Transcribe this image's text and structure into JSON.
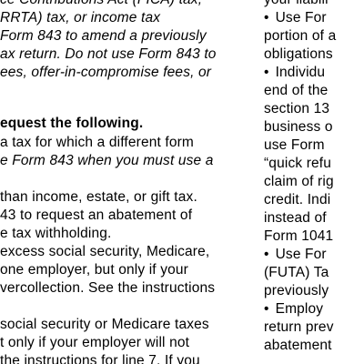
{
  "left_column": {
    "p1_line1": "ce Contributions Act (FICA) tax,",
    "p1_line2": "RRTA) tax, or income tax",
    "p1_line3": "Form 843 to amend a previously",
    "p1_line4": "ax return. Do not use Form 843 to",
    "p1_line5": "ees, offer-in-compromise fees, or",
    "heading": "equest the following.",
    "p2_line1": "a tax for which a different form",
    "p2_line2": "e Form 843 when you must use a",
    "p3_line1": "than income, estate, or gift tax.",
    "p3_line2": "43 to request an abatement of",
    "p3_line3": "e tax withholding.",
    "p4_line1": "excess social security, Medicare,",
    "p4_line2": "one employer, but only if your",
    "p4_line3": "vercollection. See the instructions",
    "p5_line1": "social security or Medicare taxes",
    "p5_line2": "t only if your employer will not",
    "p5_line3": "the instructions for line 7. If you"
  },
  "right_column": {
    "r1": "your liabili",
    "b1_l1": "Use For",
    "b1_l2": "portion of a",
    "b1_l3": "obligations",
    "b2_l1": "Individu",
    "b2_l2": "end of the",
    "b2_l3": "section 13",
    "b2_l4": "business o",
    "b2_l5": "use Form",
    "b2_l6": "“quick refu",
    "b2_l7": "claim of rig",
    "b2_l8": "credit. Indi",
    "b2_l9": "instead of",
    "b2_l10": "Form 1041",
    "b3_l1": "Use For",
    "b3_l2": "(FUTA) Ta",
    "b3_l3": "previously",
    "b4_l1": "Employ",
    "b4_l2": "return prev",
    "b4_l3": "abatement",
    "bullet": "•"
  }
}
